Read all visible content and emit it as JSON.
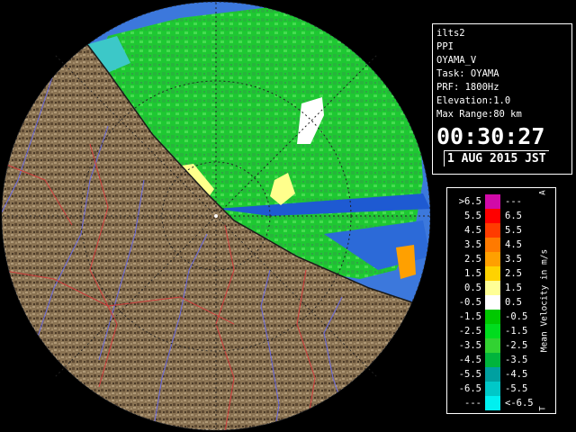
{
  "info": {
    "product": "ilts2",
    "scan_type": "PPI",
    "radar_name": "OYAMA_V",
    "task": "Task: OYAMA",
    "prf": "PRF: 1800Hz",
    "elevation": "Elevation:1.0",
    "max_range": "Max Range:80 km",
    "time": "00:30:27",
    "date": "1 AUG 2015 JST"
  },
  "legend": {
    "title": "Mean Velocity in m/s",
    "marker_top": "A",
    "marker_bottom": "T",
    "rows": [
      {
        "lo": ">6.5",
        "hi": "---",
        "color": "#d10aa8"
      },
      {
        "lo": "5.5",
        "hi": "6.5",
        "color": "#ff0000"
      },
      {
        "lo": "4.5",
        "hi": "5.5",
        "color": "#ff3c00"
      },
      {
        "lo": "3.5",
        "hi": "4.5",
        "color": "#ff7a00"
      },
      {
        "lo": "2.5",
        "hi": "3.5",
        "color": "#ffa000"
      },
      {
        "lo": "1.5",
        "hi": "2.5",
        "color": "#ffd200"
      },
      {
        "lo": "0.5",
        "hi": "1.5",
        "color": "#ffff96"
      },
      {
        "lo": "-0.5",
        "hi": "0.5",
        "color": "#ffffff"
      },
      {
        "lo": "-1.5",
        "hi": "-0.5",
        "color": "#00c800"
      },
      {
        "lo": "-2.5",
        "hi": "-1.5",
        "color": "#00dc1e"
      },
      {
        "lo": "-3.5",
        "hi": "-2.5",
        "color": "#32d232"
      },
      {
        "lo": "-4.5",
        "hi": "-3.5",
        "color": "#00b43c"
      },
      {
        "lo": "-5.5",
        "hi": "-4.5",
        "color": "#00a0a0"
      },
      {
        "lo": "-6.5",
        "hi": "-5.5",
        "color": "#00c8c8"
      },
      {
        "lo": "---",
        "hi": "<-6.5",
        "color": "#00f0f0"
      }
    ]
  },
  "colors": {
    "sea": "#3c78dc",
    "deep_sea": "#1e5ad2",
    "land": "#8a7353",
    "rivers": "#6a6ae0",
    "boundaries": "#d23c3c"
  }
}
